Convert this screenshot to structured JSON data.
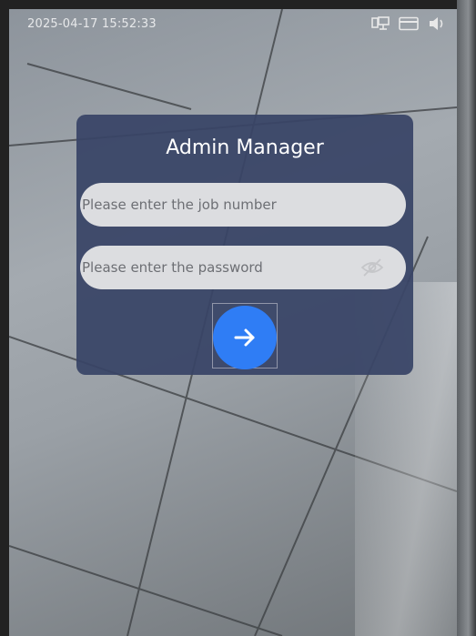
{
  "status_bar": {
    "datetime": "2025-04-17 15:52:33",
    "icons": [
      "network-icon",
      "card-icon",
      "volume-icon"
    ]
  },
  "login_dialog": {
    "title": "Admin Manager",
    "job_number_placeholder": "Please enter the job number",
    "job_number_value": "",
    "password_placeholder": "Please enter the password",
    "password_value": "",
    "password_toggle_icon": "eye-hidden-icon",
    "submit_icon": "arrow-right-icon"
  },
  "colors": {
    "dialog_background": "#384466",
    "submit_button": "#2f7df5",
    "input_background": "#dcdde0"
  }
}
